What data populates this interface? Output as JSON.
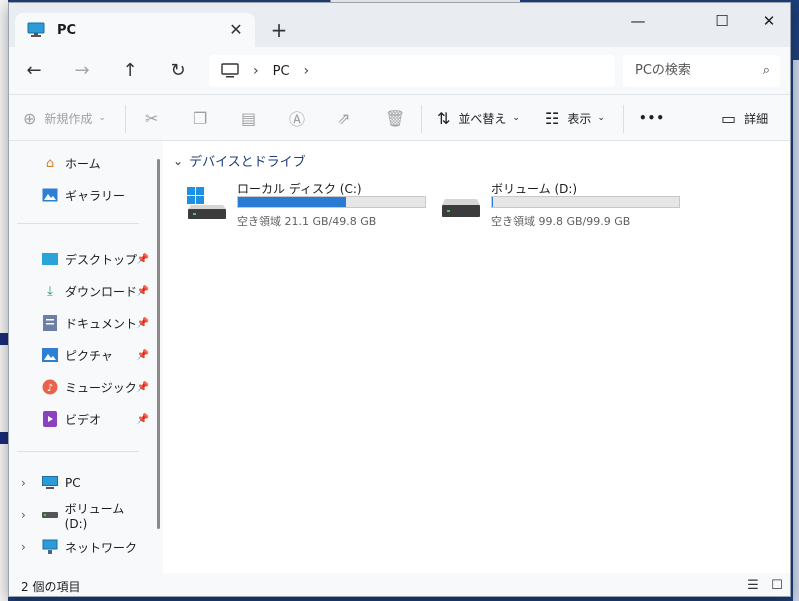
{
  "tab": {
    "title": "PC",
    "close": "✕",
    "add": "+"
  },
  "window_controls": {
    "minimize": "—",
    "maximize": "☐",
    "close": "✕"
  },
  "nav": {
    "back": "←",
    "forward": "→",
    "up": "↑",
    "refresh": "↻",
    "chevron": "›"
  },
  "address": {
    "location": "PC"
  },
  "search": {
    "placeholder": "PCの検索",
    "icon": "⌕"
  },
  "toolbar": {
    "new_label": "新規作成",
    "sort_label": "並べ替え",
    "view_label": "表示",
    "more_label": "•••",
    "details_label": "詳細"
  },
  "sidebar": {
    "home": "ホーム",
    "gallery": "ギャラリー",
    "pinned": [
      {
        "label": "デスクトップ",
        "icon": "desktop-folder-icon"
      },
      {
        "label": "ダウンロード",
        "icon": "download-folder-icon"
      },
      {
        "label": "ドキュメント",
        "icon": "documents-folder-icon"
      },
      {
        "label": "ピクチャ",
        "icon": "pictures-folder-icon"
      },
      {
        "label": "ミュージック",
        "icon": "music-folder-icon"
      },
      {
        "label": "ビデオ",
        "icon": "videos-folder-icon"
      }
    ],
    "tree": [
      {
        "label": "PC",
        "icon": "monitor-icon"
      },
      {
        "label": "ボリューム (D:)",
        "icon": "drive-icon"
      },
      {
        "label": "ネットワーク",
        "icon": "network-icon"
      }
    ]
  },
  "content": {
    "group_title": "デバイスとドライブ",
    "drives": [
      {
        "name": "ローカル ディスク (C:)",
        "space": "空き領域 21.1 GB/49.8 GB",
        "used_fraction": 0.576,
        "system": true
      },
      {
        "name": "ボリューム (D:)",
        "space": "空き領域 99.8 GB/99.9 GB",
        "used_fraction": 0.001,
        "system": false
      }
    ]
  },
  "status": {
    "item_count": "2 個の項目"
  },
  "colors": {
    "accent": "#2a7bd4",
    "group_header": "#1e3c78"
  }
}
